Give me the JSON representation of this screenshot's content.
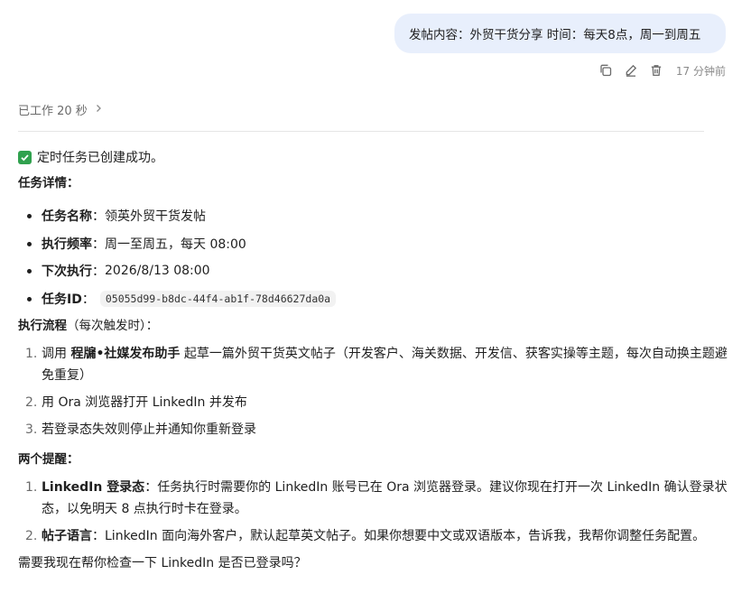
{
  "user_message": {
    "text": "发帖内容：外贸干货分享 时间：每天8点，周一到周五",
    "timestamp": "17 分钟前"
  },
  "actions": [
    {
      "name": "copy-icon"
    },
    {
      "name": "edit-icon"
    },
    {
      "name": "delete-icon"
    }
  ],
  "status": {
    "worked_label": "已工作 20 秒"
  },
  "reply": {
    "success": "定时任务已创建成功。",
    "details_heading": "任务详情：",
    "details": [
      {
        "key": "任务名称",
        "sep": "：",
        "value": "领英外贸干货发帖"
      },
      {
        "key": "执行频率",
        "sep": "：",
        "value": "周一至周五，每天 08:00"
      },
      {
        "key": "下次执行",
        "sep": "：",
        "value": "2026/8/13 08:00"
      },
      {
        "key": "任务ID",
        "sep": "：",
        "value": "05055d99-b8dc-44f4-ab1f-78d46627da0a"
      }
    ],
    "flow_heading_bold": "执行流程",
    "flow_heading_rest": "（每次触发时）：",
    "flow_steps": [
      {
        "num": "1.",
        "pre": "调用 ",
        "bold": "程牖•社媒发布助手",
        "post": " 起草一篇外贸干货英文帖子（开发客户、海关数据、开发信、获客实操等主题，每次自动换主题避免重复）"
      },
      {
        "num": "2.",
        "pre": "用 Ora 浏览器打开 LinkedIn 并发布",
        "bold": "",
        "post": ""
      },
      {
        "num": "3.",
        "pre": "若登录态失效则停止并通知你重新登录",
        "bold": "",
        "post": ""
      }
    ],
    "reminders_heading": "两个提醒：",
    "reminders": [
      {
        "num": "1.",
        "key": "LinkedIn 登录态",
        "sep": "：",
        "text": "任务执行时需要你的 LinkedIn 账号已在 Ora 浏览器登录。建议你现在打开一次 LinkedIn 确认登录状态，以免明天 8 点执行时卡在登录。"
      },
      {
        "num": "2.",
        "key": "帖子语言",
        "sep": "：",
        "text": "LinkedIn 面向海外客户，默认起草英文帖子。如果你想要中文或双语版本，告诉我，我帮你调整任务配置。"
      }
    ],
    "question": "需要我现在帮你检查一下 LinkedIn 是否已登录吗？"
  }
}
